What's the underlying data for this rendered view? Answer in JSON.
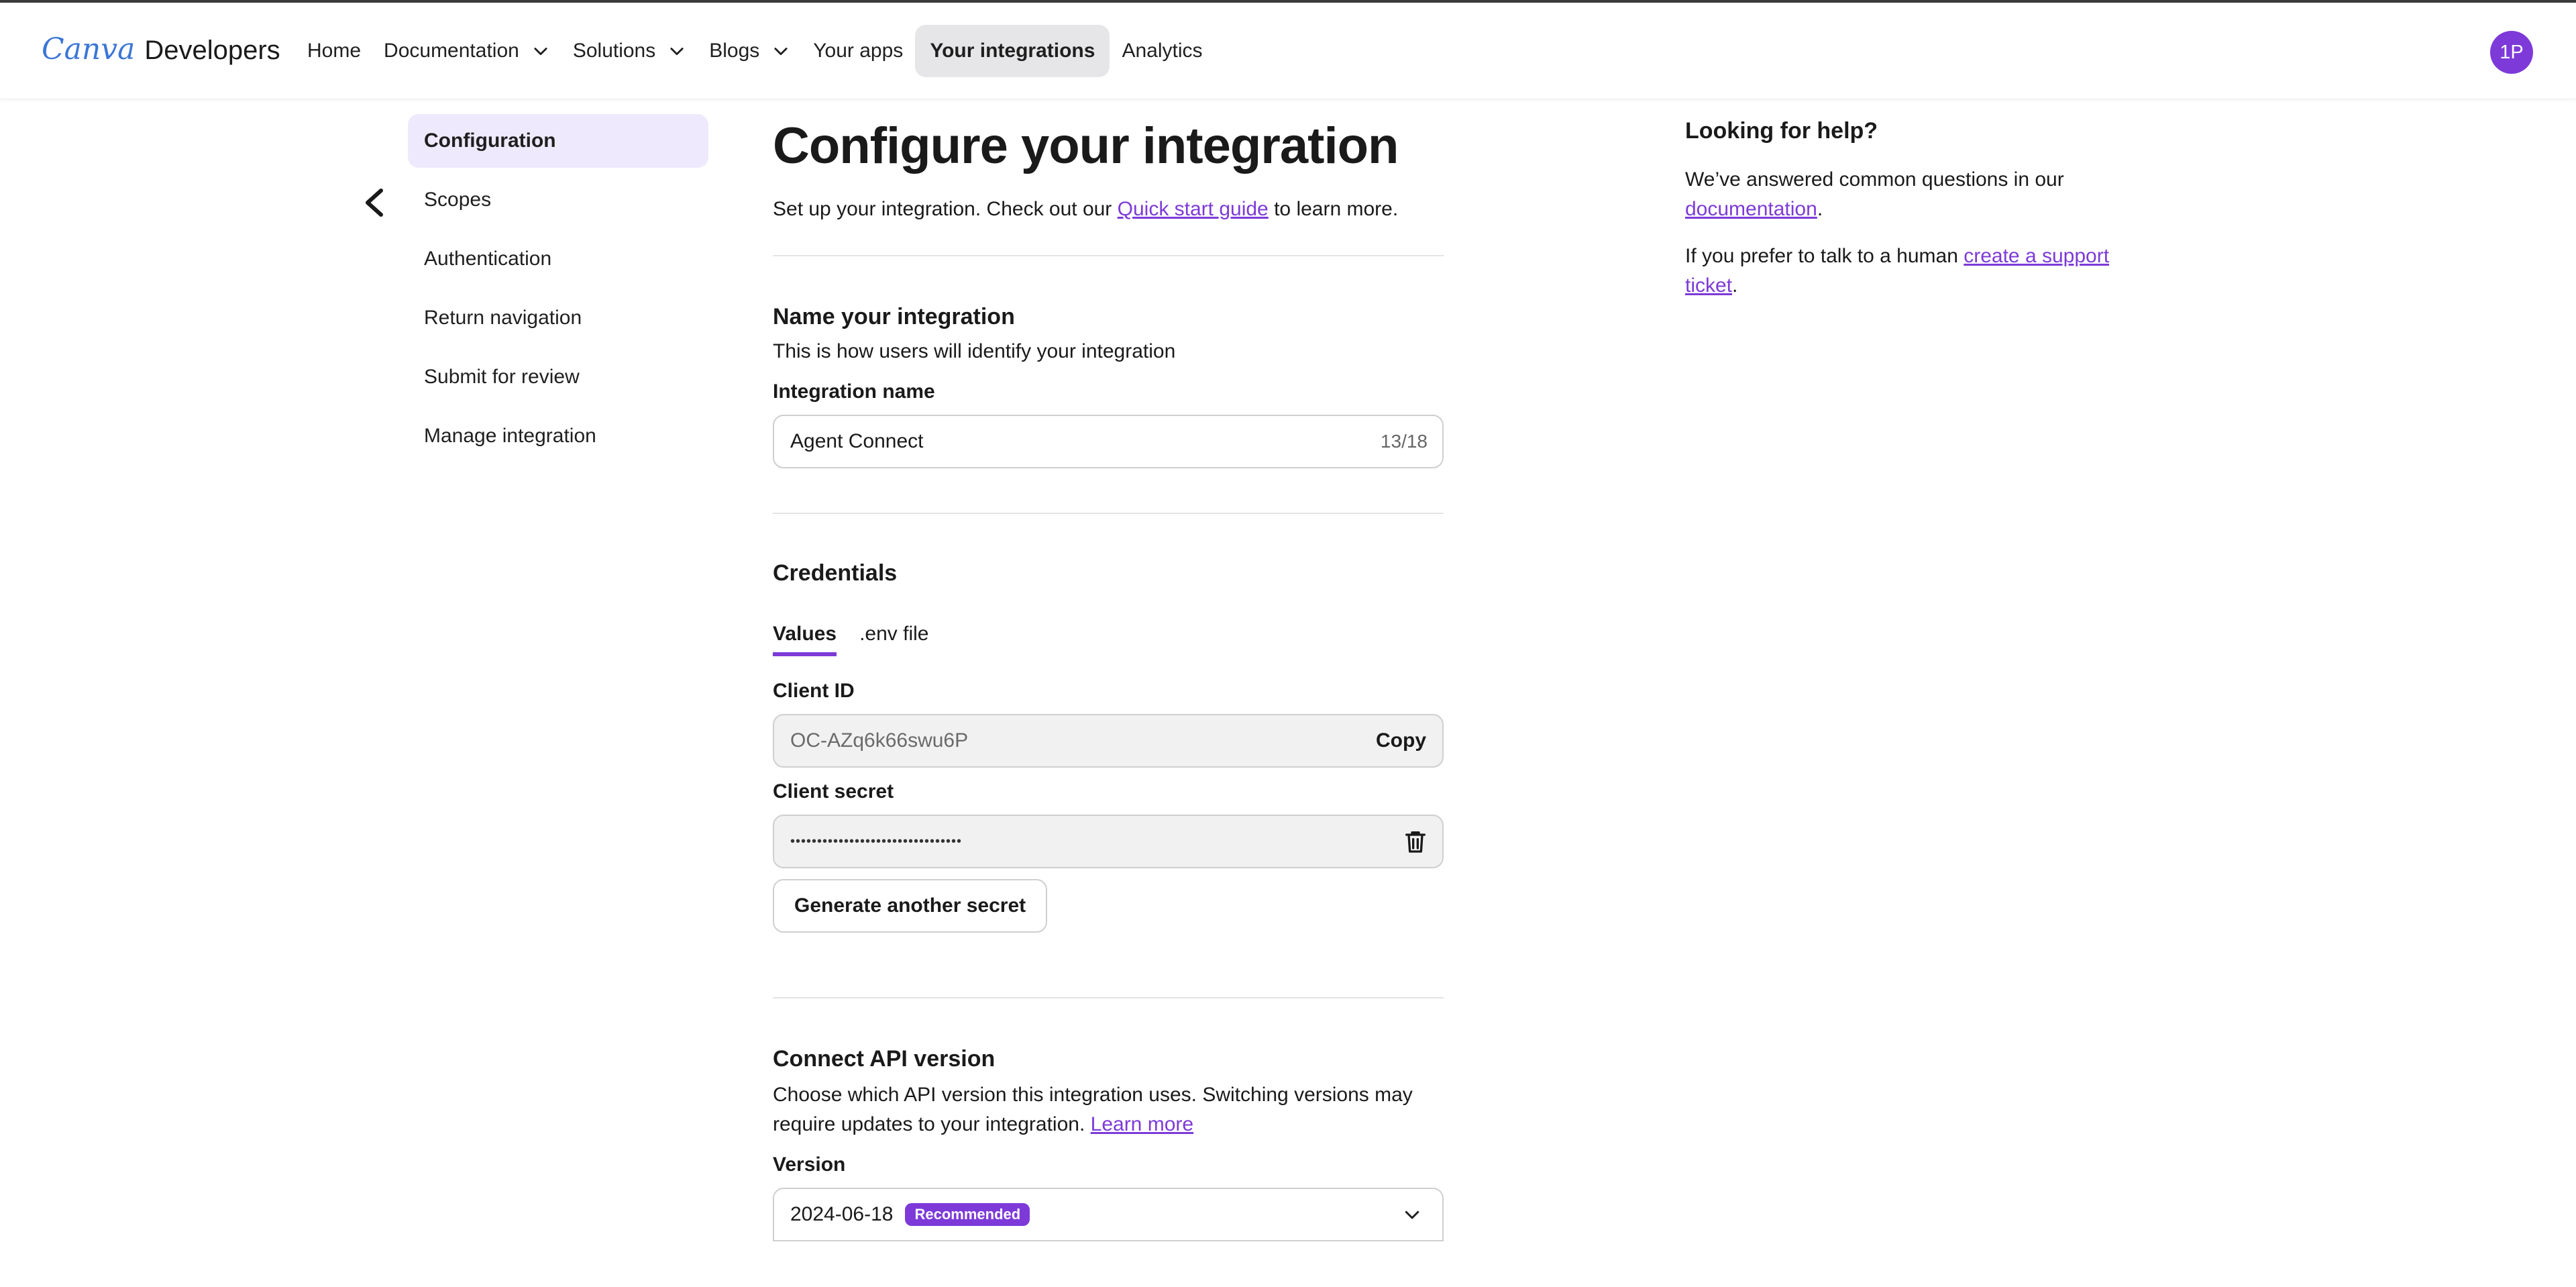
{
  "header": {
    "logo_canva": "Canva",
    "logo_developers": "Developers",
    "nav": [
      {
        "label": "Home"
      },
      {
        "label": "Documentation"
      },
      {
        "label": "Solutions"
      },
      {
        "label": "Blogs"
      },
      {
        "label": "Your apps"
      },
      {
        "label": "Your integrations"
      },
      {
        "label": "Analytics"
      }
    ],
    "avatar_initials": "1P"
  },
  "sidebar": {
    "items": [
      {
        "label": "Configuration"
      },
      {
        "label": "Scopes"
      },
      {
        "label": "Authentication"
      },
      {
        "label": "Return navigation"
      },
      {
        "label": "Submit for review"
      },
      {
        "label": "Manage integration"
      }
    ]
  },
  "main": {
    "title": "Configure your integration",
    "intro_prefix": "Set up your integration. Check out our ",
    "intro_link": "Quick start guide",
    "intro_suffix": " to learn more.",
    "name_section": {
      "heading": "Name your integration",
      "description": "This is how users will identify your integration",
      "field_label": "Integration name",
      "value": "Agent Connect",
      "counter": "13/18"
    },
    "credentials": {
      "heading": "Credentials",
      "tabs": [
        "Values",
        ".env file"
      ],
      "client_id_label": "Client ID",
      "client_id": "OC-AZq6k66swu6P",
      "copy_label": "Copy",
      "client_secret_label": "Client secret",
      "client_secret_masked": "••••••••••••••••••••••••••••••••",
      "generate_label": "Generate another secret"
    },
    "api_version": {
      "heading": "Connect API version",
      "description": "Choose which API version this integration uses. Switching versions may require updates to your integration. ",
      "learn_more": "Learn more",
      "version_label": "Version",
      "version_value": "2024-06-18",
      "badge": "Recommended"
    }
  },
  "help": {
    "title": "Looking for help?",
    "p1_prefix": "We’ve answered common questions in our ",
    "p1_link": "documentation",
    "p1_suffix": ".",
    "p2_prefix": "If you prefer to talk to a human ",
    "p2_link": "create a support ticket",
    "p2_suffix": "."
  },
  "colors": {
    "accent": "#7d3ad8",
    "active_nav_bg": "#e6e6e8",
    "active_side_bg": "#efe9fd"
  }
}
